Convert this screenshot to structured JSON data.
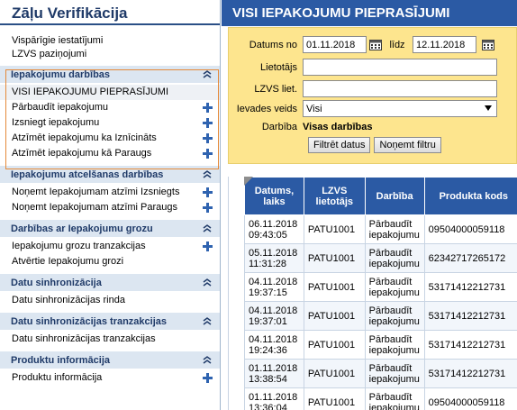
{
  "sidebar": {
    "title": "Zāļu Verifikācija",
    "top_links": [
      "Vispārīgie iestatījumi",
      "LZVS paziņojumi"
    ],
    "sections": [
      {
        "title": "Iepakojumu darbības",
        "items": [
          {
            "label": "VISI IEPAKOJUMU PIEPRASĪJUMI",
            "plus": false,
            "active": true
          },
          {
            "label": "Pārbaudīt iepakojumu",
            "plus": true
          },
          {
            "label": "Izsniegt iepakojumu",
            "plus": true
          },
          {
            "label": "Atzīmēt iepakojumu ka Iznīcināts",
            "plus": true
          },
          {
            "label": "Atzīmēt iepakojumu kā Paraugs",
            "plus": true
          }
        ]
      },
      {
        "title": "Iepakojumu atcelšanas darbības",
        "items": [
          {
            "label": "Noņemt Iepakojumam atzīmi Izsniegts",
            "plus": true
          },
          {
            "label": "Noņemt Iepakojumam atzīmi Paraugs",
            "plus": true
          }
        ]
      },
      {
        "title": "Darbības ar Iepakojumu grozu",
        "items": [
          {
            "label": "Iepakojumu grozu tranzakcijas",
            "plus": true
          },
          {
            "label": "Atvērtie Iepakojumu grozi",
            "plus": false
          }
        ]
      },
      {
        "title": "Datu sinhronizācija",
        "items": [
          {
            "label": "Datu sinhronizācijas rinda",
            "plus": false
          }
        ]
      },
      {
        "title": "Datu sinhronizācijas tranzakcijas",
        "items": [
          {
            "label": "Datu sinhronizācijas tranzakcijas",
            "plus": false
          }
        ]
      },
      {
        "title": "Produktu informācija",
        "items": [
          {
            "label": "Produktu informācija",
            "plus": true
          }
        ]
      }
    ]
  },
  "main": {
    "title": "VISI IEPAKOJUMU PIEPRASĪJUMI",
    "filter": {
      "date_from_label": "Datums no",
      "date_from": "01.11.2018",
      "date_to_label": "līdz",
      "date_to": "12.11.2018",
      "user_label": "Lietotājs",
      "user_value": "",
      "lzvs_user_label": "LZVS liet.",
      "lzvs_user_value": "",
      "input_type_label": "Ievades veids",
      "input_type_value": "Visi",
      "action_label": "Darbība",
      "action_value": "Visas darbības",
      "filter_button": "Filtrēt datus",
      "clear_button": "Noņemt filtru"
    },
    "table": {
      "headers": [
        "Datums, laiks",
        "LZVS lietotājs",
        "Darbība",
        "Produkta kods"
      ],
      "rows": [
        [
          "06.11.2018 09:43:05",
          "PATU1001",
          "Pārbaudīt iepakojumu",
          "09504000059118"
        ],
        [
          "05.11.2018 11:31:28",
          "PATU1001",
          "Pārbaudīt iepakojumu",
          "62342717265172"
        ],
        [
          "04.11.2018 19:37:15",
          "PATU1001",
          "Pārbaudīt iepakojumu",
          "53171412212731"
        ],
        [
          "04.11.2018 19:37:01",
          "PATU1001",
          "Pārbaudīt iepakojumu",
          "53171412212731"
        ],
        [
          "04.11.2018 19:24:36",
          "PATU1001",
          "Pārbaudīt iepakojumu",
          "53171412212731"
        ],
        [
          "01.11.2018 13:38:54",
          "PATU1001",
          "Pārbaudīt iepakojumu",
          "53171412212731"
        ],
        [
          "01.11.2018 13:36:04",
          "PATU1001",
          "Pārbaudīt iepakojumu",
          "09504000059118"
        ]
      ]
    }
  },
  "colors": {
    "accent": "#2b5aa4",
    "section_bg": "#dce6f1",
    "filter_bg": "#fde58e",
    "plus": "#2f63b0",
    "highlight_border": "#e58a3a"
  }
}
